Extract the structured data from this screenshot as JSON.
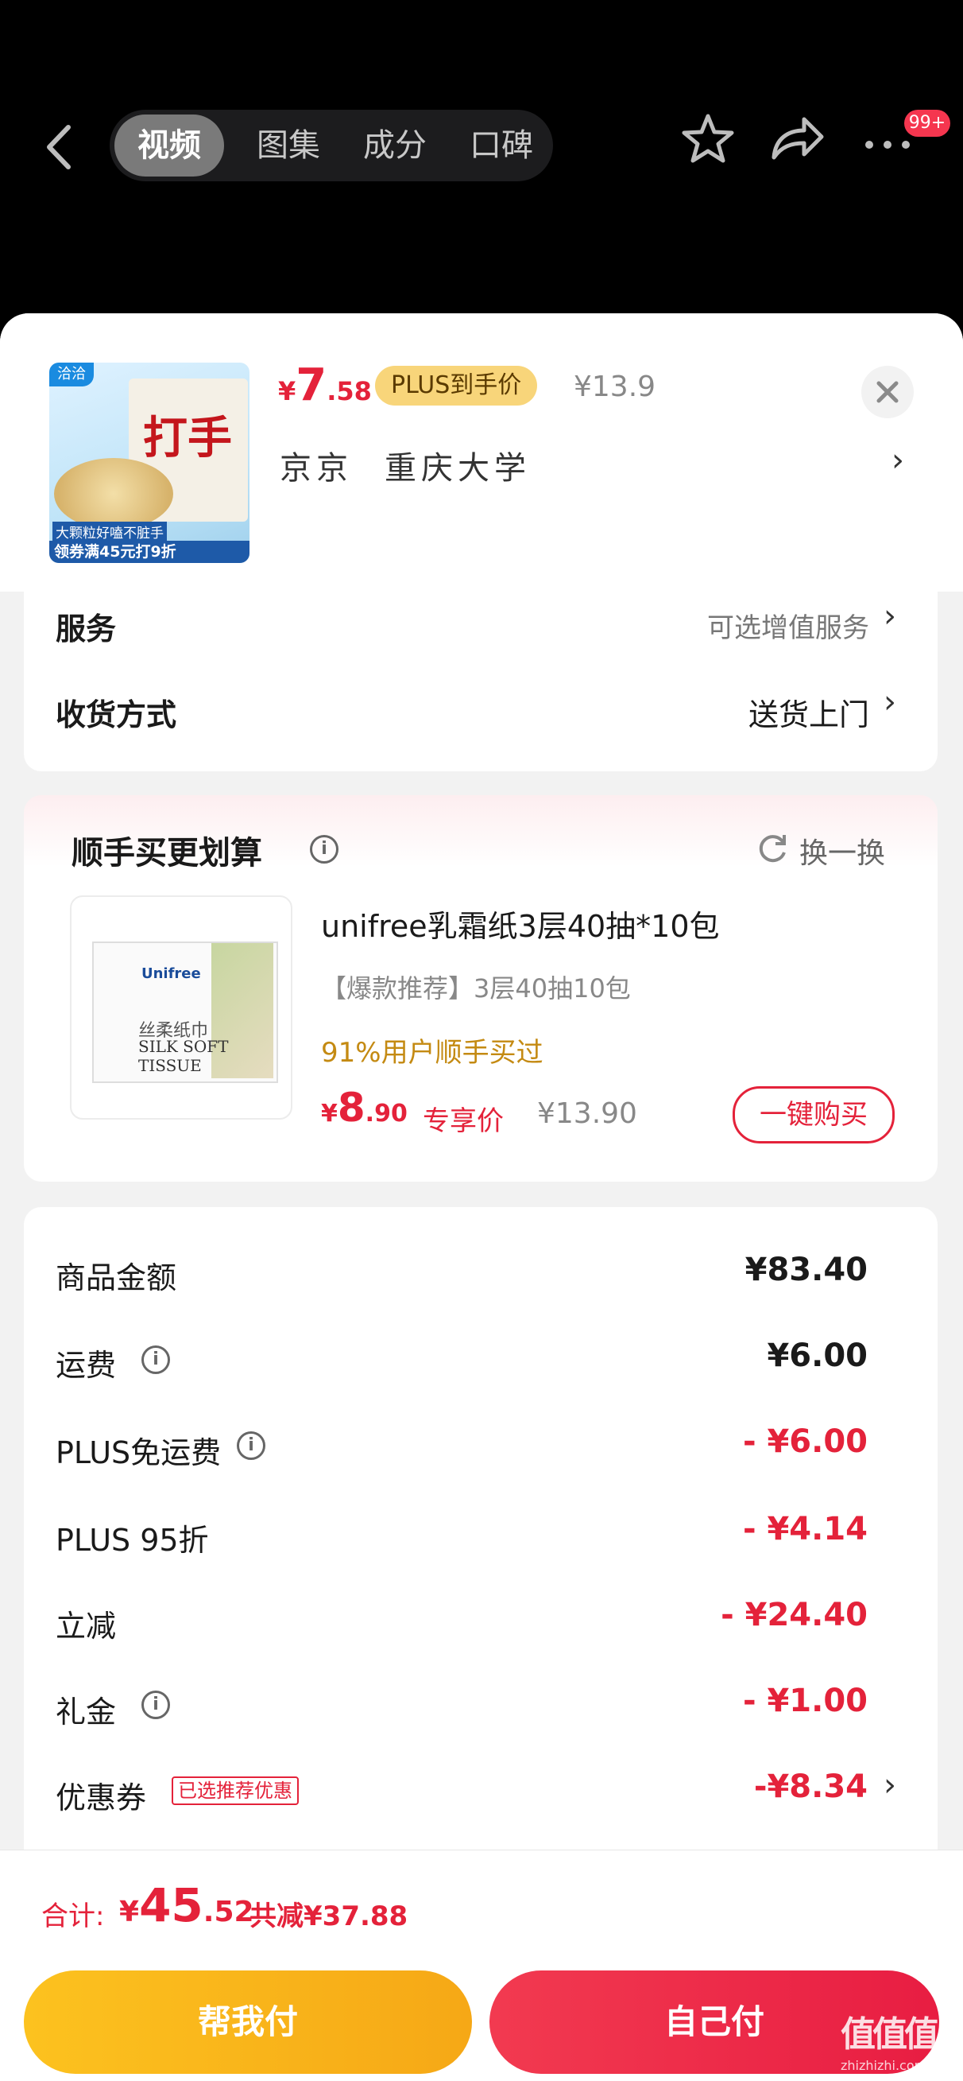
{
  "topbar": {
    "tabs": [
      "视频",
      "图集",
      "成分",
      "口碑"
    ],
    "badge": "99+"
  },
  "product": {
    "thumb_title": "打手",
    "thumb_brand": "洽洽",
    "thumb_caption": "大颗粒好嗑不脏手",
    "thumb_coupon": "领券满45元打9折",
    "price_symbol": "¥",
    "price_int": "7",
    "price_dec": ".58",
    "plus_label": "PLUS到手价",
    "orig_price": "¥13.9",
    "address_name": "京京",
    "address_place": "重庆大学"
  },
  "options": {
    "service_label": "服务",
    "service_value": "可选增值服务",
    "delivery_label": "收货方式",
    "delivery_value": "送货上门"
  },
  "addon": {
    "title": "顺手买更划算",
    "refresh_label": "换一换",
    "name": "unifree乳霜纸3层40抽*10包",
    "tag": "【爆款推荐】3层40抽10包",
    "social": "91%用户顺手买过",
    "price_symbol": "¥",
    "price_int": "8",
    "price_dec": ".90",
    "price_label": "专享价",
    "orig_price": "¥13.90",
    "buy_label": "一键购买",
    "pack_brand": "Unifree",
    "pack_name": "丝柔纸巾",
    "pack_en1": "SILK SOFT",
    "pack_en2": "TISSUE"
  },
  "summary": {
    "rows": [
      {
        "label": "商品金额",
        "value": "¥83.40"
      },
      {
        "label": "运费",
        "value": "¥6.00"
      },
      {
        "label": "PLUS免运费",
        "value": "- ¥6.00"
      },
      {
        "label": "PLUS 95折",
        "value": "- ¥4.14"
      },
      {
        "label": "立减",
        "value": "- ¥24.40"
      },
      {
        "label": "礼金",
        "value": "- ¥1.00"
      },
      {
        "label": "优惠券",
        "value": "-¥8.34",
        "tag": "已选推荐优惠"
      }
    ]
  },
  "footer": {
    "total_label": "合计:",
    "total_symbol": "¥",
    "total_int": "45",
    "total_dec": ".52",
    "saved": "共减¥37.88",
    "help_pay": "帮我付",
    "self_pay": "自己付",
    "watermark": "值值值",
    "watermark_url": "zhizhizhi.com"
  },
  "colors": {
    "accent_red": "#e4223a",
    "plus_gold": "#f8d57a",
    "help_btn": "#f9b51b",
    "self_btn": "#f23a50"
  }
}
